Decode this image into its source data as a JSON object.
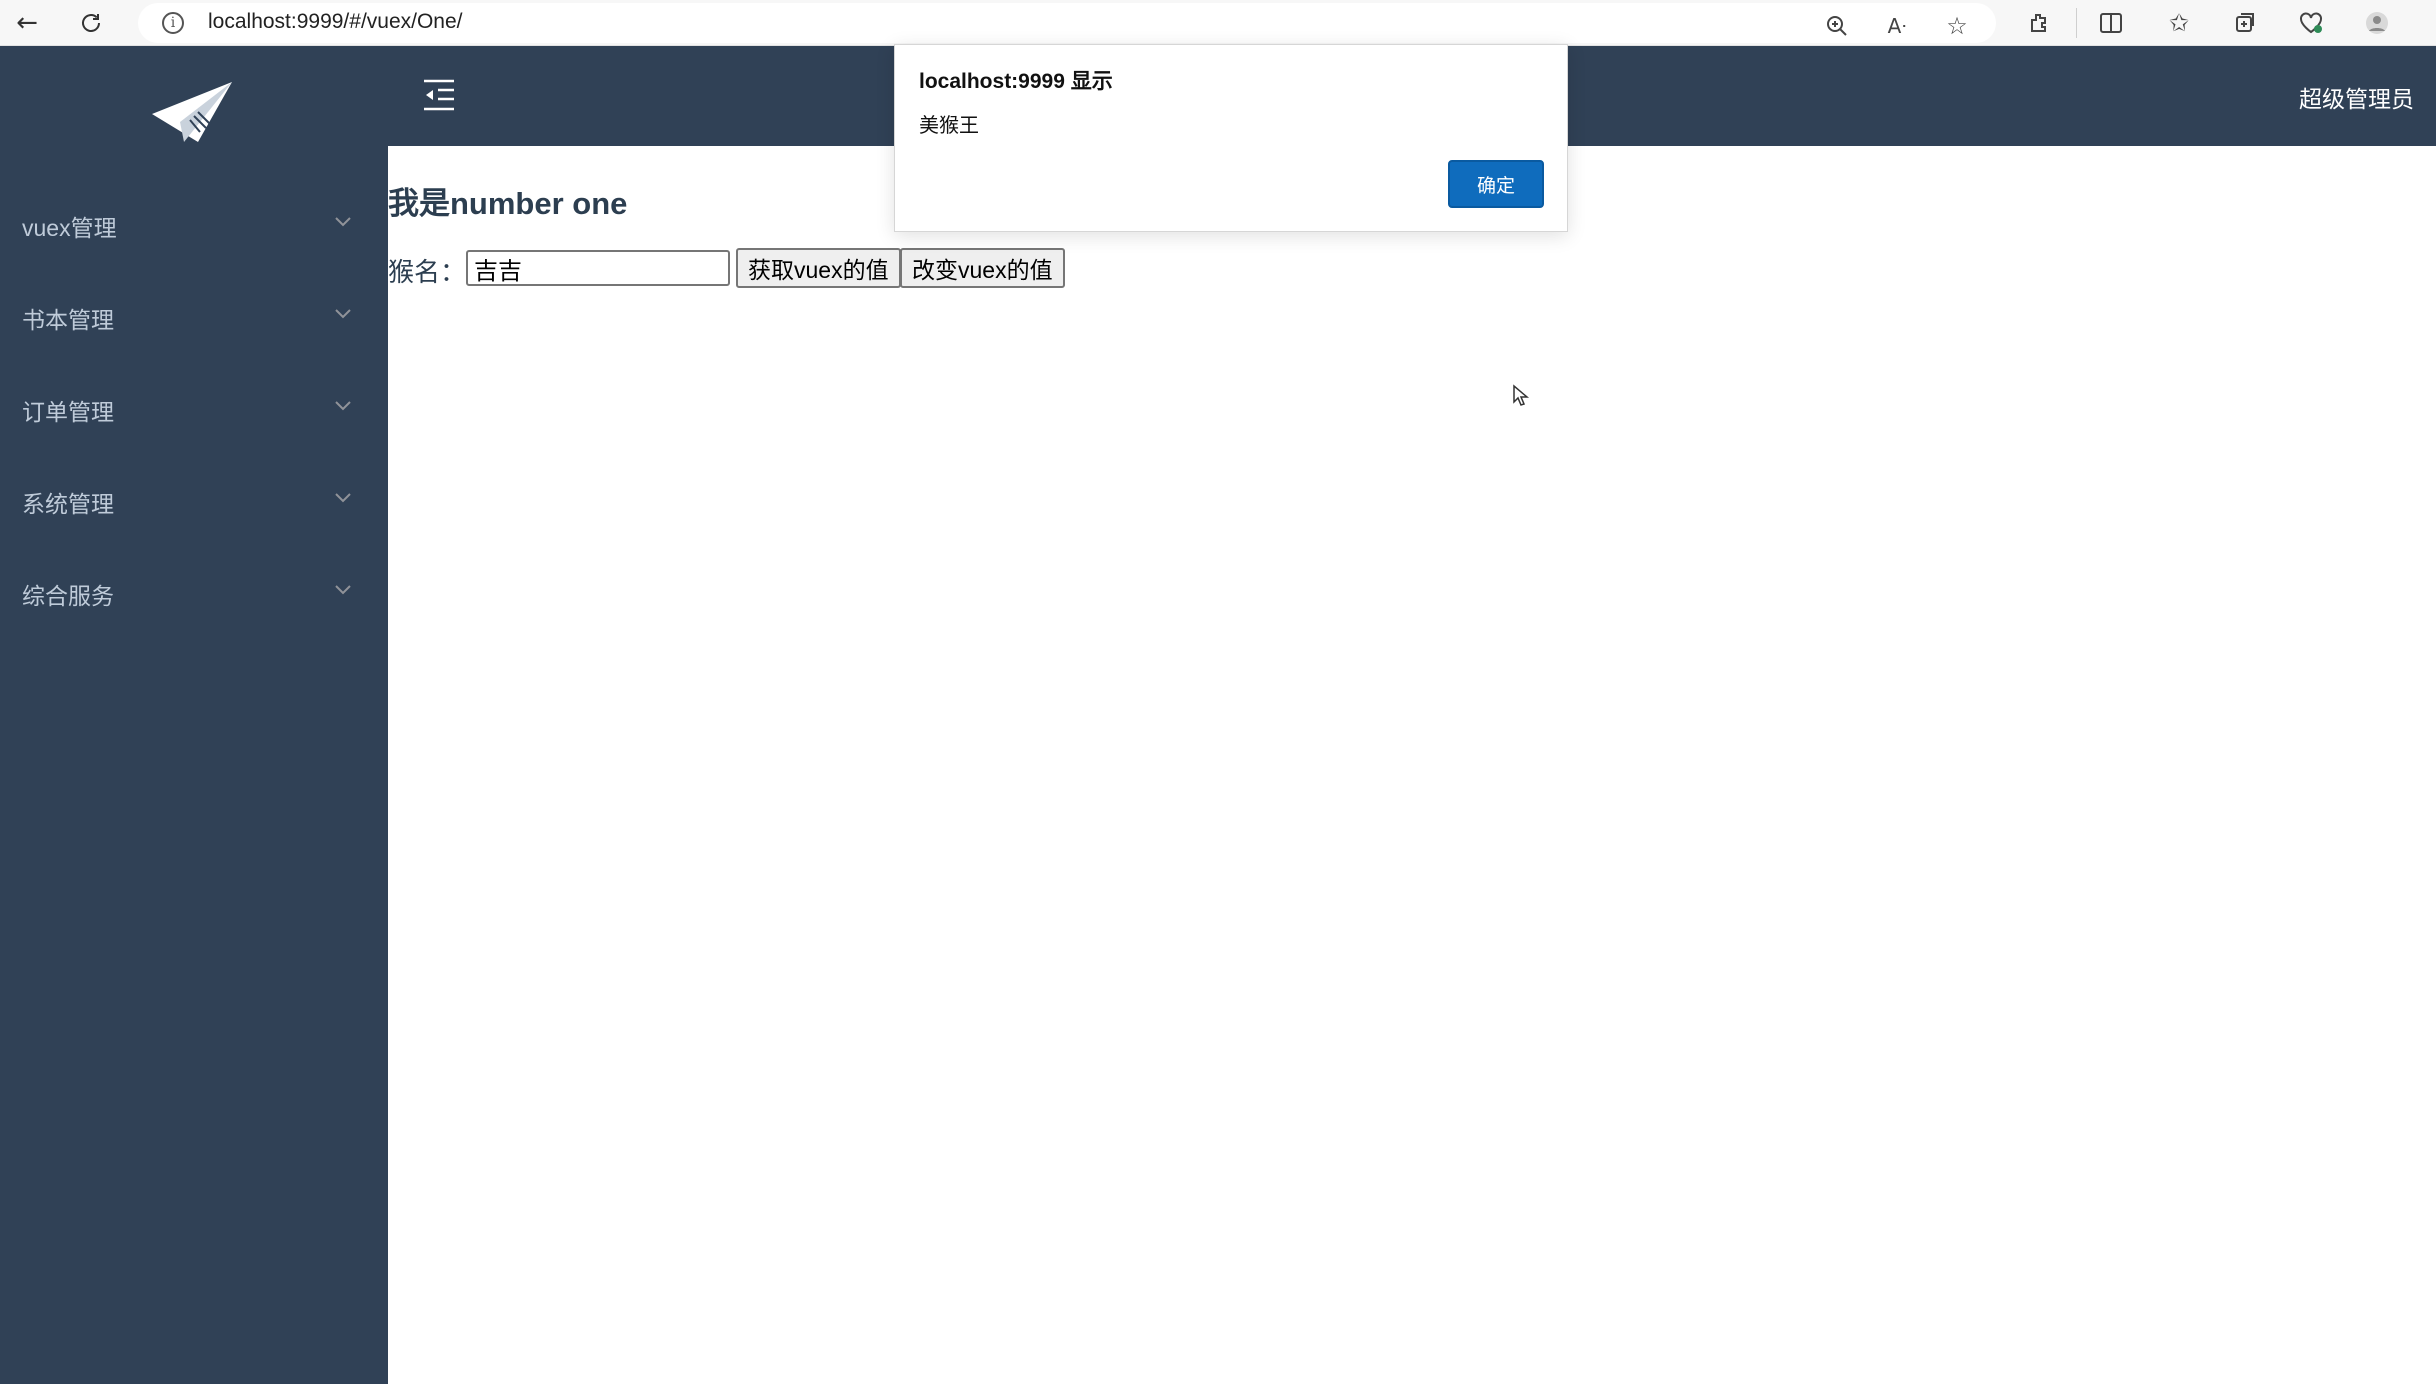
{
  "browser": {
    "url": "localhost:9999/#/vuex/One/",
    "info_icon": "i",
    "icons": [
      "back-icon",
      "reload-icon",
      "zoom-icon",
      "read-aloud-icon",
      "favorite-icon",
      "extensions-icon",
      "split-screen-icon",
      "favorites-icon",
      "collections-icon",
      "browser-essentials-icon",
      "profile-icon"
    ]
  },
  "sidebar": {
    "items": [
      {
        "label": "vuex管理"
      },
      {
        "label": "书本管理"
      },
      {
        "label": "订单管理"
      },
      {
        "label": "系统管理"
      },
      {
        "label": "综合服务"
      }
    ]
  },
  "header": {
    "user": "超级管理员"
  },
  "main": {
    "title": "我是number one",
    "label": "猴名：",
    "input_value": "吉吉",
    "get_button": "获取vuex的值",
    "change_button": "改变vuex的值"
  },
  "dialog": {
    "title": "localhost:9999 显示",
    "message": "美猴王",
    "ok_label": "确定"
  },
  "colors": {
    "sidebar_bg": "#304156",
    "menu_text": "#bfcbd9",
    "accent": "#0f6cbd"
  }
}
